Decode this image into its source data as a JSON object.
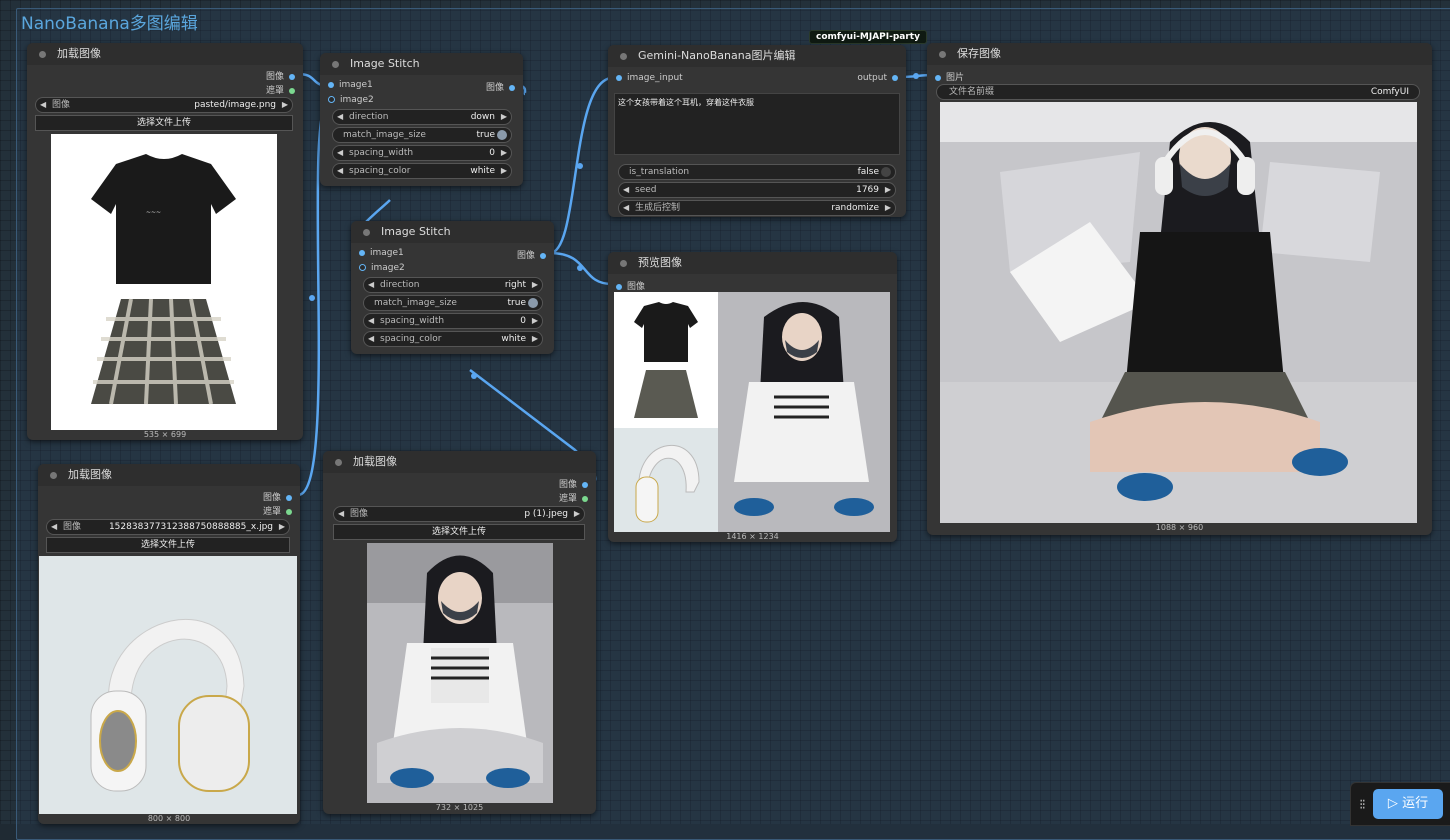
{
  "group": {
    "title": "NanoBanana多图编辑"
  },
  "badge": "comfyui-MJAPI-party",
  "load1": {
    "title": "加载图像",
    "out_image": "图像",
    "out_mask": "遮罩",
    "image_label": "图像",
    "image_value": "pasted/image.png",
    "upload": "选择文件上传",
    "size": "535 × 699"
  },
  "load2": {
    "title": "加载图像",
    "out_image": "图像",
    "out_mask": "遮罩",
    "image_label": "图像",
    "image_value": "1528383773123887508888​85_x.jpg",
    "upload": "选择文件上传",
    "size": "800 × 800"
  },
  "load3": {
    "title": "加载图像",
    "out_image": "图像",
    "out_mask": "遮罩",
    "image_label": "图像",
    "image_value": "p (1).jpeg",
    "upload": "选择文件上传",
    "size": "732 × 1025"
  },
  "stitch1": {
    "title": "Image Stitch",
    "in1": "image1",
    "in2": "image2",
    "out": "图像",
    "direction_label": "direction",
    "direction": "down",
    "match_label": "match_image_size",
    "match": "true",
    "spacing_width_label": "spacing_width",
    "spacing_width": "0",
    "spacing_color_label": "spacing_color",
    "spacing_color": "white"
  },
  "stitch2": {
    "title": "Image Stitch",
    "in1": "image1",
    "in2": "image2",
    "out": "图像",
    "direction_label": "direction",
    "direction": "right",
    "match_label": "match_image_size",
    "match": "true",
    "spacing_width_label": "spacing_width",
    "spacing_width": "0",
    "spacing_color_label": "spacing_color",
    "spacing_color": "white"
  },
  "gemini": {
    "title": "Gemini-NanoBanana图片编辑",
    "in": "image_input",
    "out": "output",
    "prompt": "这个女孩带着这个耳机，穿着这件衣服",
    "translation_label": "is_translation",
    "translation": "false",
    "seed_label": "seed",
    "seed": "1769",
    "control_label": "生成后控制",
    "control": "randomize"
  },
  "preview": {
    "title": "预览图像",
    "in": "图像",
    "size": "1416 × 1234"
  },
  "save": {
    "title": "保存图像",
    "in": "图片",
    "prefix_label": "文件名前缀",
    "prefix": "ComfyUI",
    "size": "1088 × 960"
  },
  "run": {
    "label": "运行"
  }
}
